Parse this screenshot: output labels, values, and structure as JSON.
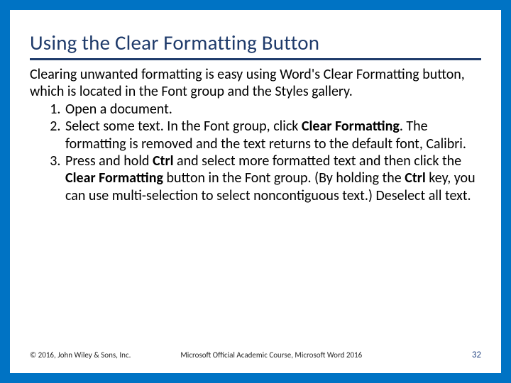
{
  "title": "Using the Clear Formatting Button",
  "intro": "Clearing unwanted formatting is easy using Word's Clear Formatting button, which is located in the Font group and the Styles gallery.",
  "steps": {
    "s1": "Open a document.",
    "s2a": "Select some text. In the Font group, click ",
    "s2b_bold": "Clear Formatting",
    "s2c": ". The formatting is removed and the text returns to the default font, Calibri.",
    "s3a": "Press and hold ",
    "s3b_bold": "Ctrl",
    "s3c": " and select more formatted text and then click the ",
    "s3d_bold": "Clear Formatting",
    "s3e": " button in the Font group. (By holding the ",
    "s3f_bold": "Ctrl",
    "s3g": " key, you can use multi-selection to select noncontiguous text.) Deselect all text."
  },
  "footer": {
    "copyright": "© 2016, John Wiley & Sons, Inc.",
    "course": "Microsoft Official Academic Course, Microsoft Word 2016",
    "page": "32"
  }
}
